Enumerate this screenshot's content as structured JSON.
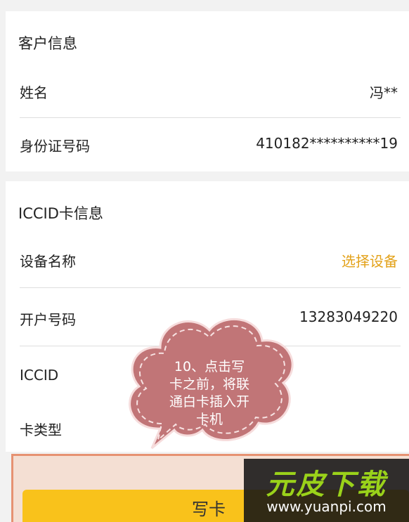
{
  "customer_info": {
    "title": "客户信息",
    "name_label": "姓名",
    "name_value": "冯**",
    "id_label": "身份证号码",
    "id_value": "410182**********19"
  },
  "iccid_info": {
    "title": "ICCID卡信息",
    "device_label": "设备名称",
    "device_value": "选择设备",
    "account_label": "开户号码",
    "account_value": "13283049220",
    "iccid_label": "ICCID",
    "card_type_label": "卡类型"
  },
  "annotation": {
    "line1": "10、点击写",
    "line2": "卡之前，将联",
    "line3": "通白卡插入开",
    "line4": "卡机"
  },
  "footer": {
    "write_card_label": "写卡"
  },
  "watermark": {
    "title": "元皮下载",
    "url": "www.yuanpi.com"
  },
  "colors": {
    "accent_orange": "#e3a21a",
    "button_yellow": "#f9c21b",
    "cloud_fill": "#c17577"
  }
}
